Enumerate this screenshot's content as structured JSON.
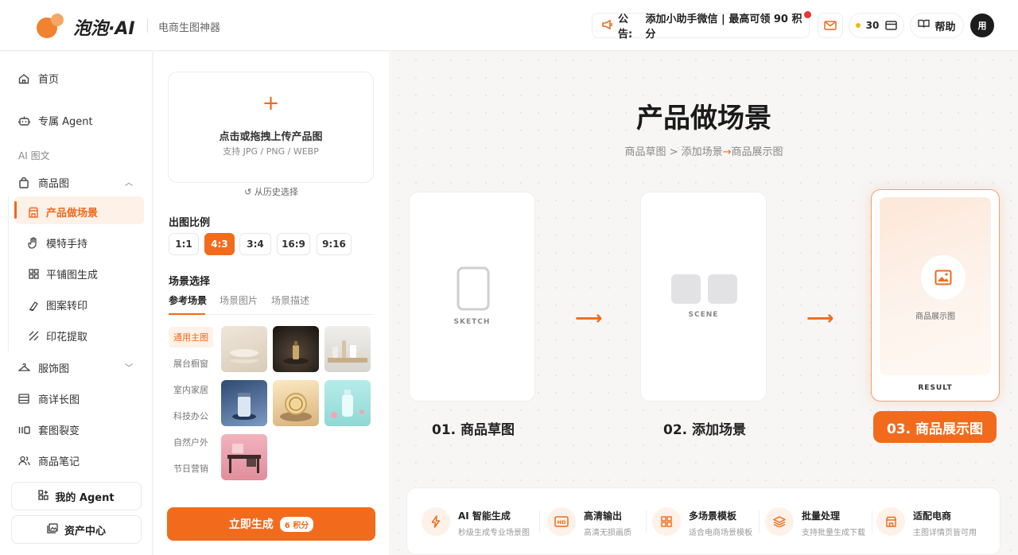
{
  "header": {
    "logo_text": "泡泡·AI",
    "subtitle": "电商生图神器",
    "notice_prefix": "公告:",
    "notice_text": "添加小助手微信 | 最高可领 90 积分",
    "credits": "30",
    "help_label": "帮助",
    "avatar_text": "用"
  },
  "sidebar": {
    "home": "首页",
    "agent": "专属 Agent",
    "section_label": "AI 图文",
    "product_image": "商品图",
    "sub_items": [
      "产品做场景",
      "模特手持",
      "平铺图生成",
      "图案转印",
      "印花提取"
    ],
    "apparel": "服饰图",
    "detail_long": "商详长图",
    "set_split": "套图裂变",
    "notes": "商品笔记",
    "my_agent_btn": "我的 Agent",
    "assets_btn": "资产中心"
  },
  "panel": {
    "upload_title": "点击或拖拽上传产品图",
    "upload_formats": "支持 JPG / PNG / WEBP",
    "history_label": "从历史选择",
    "ratio_label": "出图比例",
    "ratios": [
      "1:1",
      "4:3",
      "3:4",
      "16:9",
      "9:16"
    ],
    "selected_ratio": "4:3",
    "scene_label": "场景选择",
    "tabs": [
      "参考场景",
      "场景图片",
      "场景描述"
    ],
    "categories": [
      "通用主图",
      "展台橱窗",
      "室内家居",
      "科技办公",
      "自然户外",
      "节日营销"
    ],
    "generate_label": "立即生成",
    "generate_cost": "6 积分"
  },
  "main": {
    "title": "产品做场景",
    "flow_a": "商品草图 > 添加场景",
    "flow_b": "商品展示图",
    "card1_label": "SKETCH",
    "card2_label": "SCENE",
    "card3_caption": "商品展示图",
    "card3_label": "RESULT",
    "steps": [
      "01. 商品草图",
      "02. 添加场景",
      "03. 商品展示图"
    ]
  },
  "features": [
    {
      "title": "AI 智能生成",
      "desc": "秒级生成专业场景图"
    },
    {
      "title": "高清输出",
      "desc": "高清无损画质"
    },
    {
      "title": "多场景模板",
      "desc": "适合电商场景模板"
    },
    {
      "title": "批量处理",
      "desc": "支持批量生成下载"
    },
    {
      "title": "适配电商",
      "desc": "主图详情页皆可用"
    }
  ],
  "colors": {
    "accent": "#f26b1d",
    "accent_light": "#fdf1e8"
  }
}
